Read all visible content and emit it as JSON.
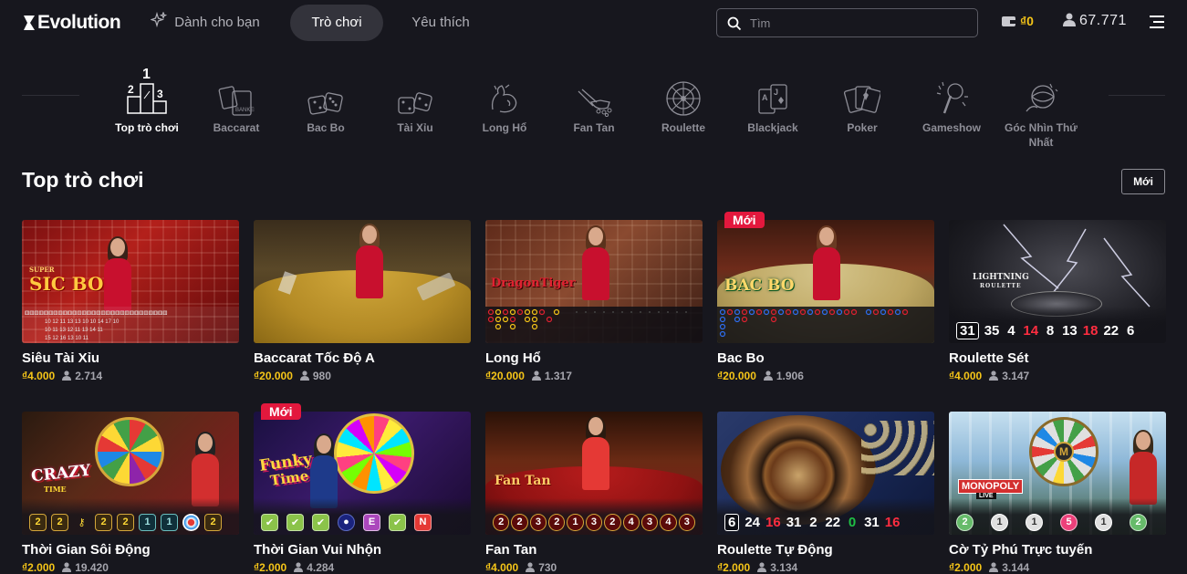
{
  "header": {
    "logo_text": "Evolution",
    "nav": [
      {
        "label": "Dành cho bạn"
      },
      {
        "label": "Trò chơi"
      },
      {
        "label": "Yêu thích"
      }
    ],
    "search_placeholder": "Tìm",
    "wallet_amount": "₫0",
    "player_count": "67.771"
  },
  "categories": [
    {
      "label": "Top trò chơi"
    },
    {
      "label": "Baccarat"
    },
    {
      "label": "Bac Bo"
    },
    {
      "label": "Tài Xỉu"
    },
    {
      "label": "Long Hổ"
    },
    {
      "label": "Fan Tan"
    },
    {
      "label": "Roulette"
    },
    {
      "label": "Blackjack"
    },
    {
      "label": "Poker"
    },
    {
      "label": "Gameshow"
    },
    {
      "label": "Góc Nhìn Thứ Nhất"
    }
  ],
  "section": {
    "title": "Top trò chơi",
    "sort_label": "Mới"
  },
  "games": [
    {
      "name": "Siêu Tài Xỉu",
      "bet": "₫4.000",
      "players": "2.714",
      "logo": "SIC BO",
      "logo_prefix": "SUPER"
    },
    {
      "name": "Baccarat Tốc Độ A",
      "bet": "₫20.000",
      "players": "980"
    },
    {
      "name": "Long Hổ",
      "bet": "₫20.000",
      "players": "1.317",
      "logo": "DragonTiger"
    },
    {
      "name": "Bac Bo",
      "bet": "₫20.000",
      "players": "1.906",
      "badge": "Mới",
      "logo": "BAC BO"
    },
    {
      "name": "Roulette Sét",
      "bet": "₫4.000",
      "players": "3.147",
      "logo": "LIGHTNING",
      "logo_sub": "ROULETTE",
      "results": [
        "31",
        "35",
        "4",
        "14",
        "8",
        "13",
        "18",
        "22",
        "6"
      ]
    },
    {
      "name": "Thời Gian Sôi Động",
      "bet": "₫2.000",
      "players": "19.420",
      "logo": "CRAZY",
      "logo_sub": "TIME",
      "results": [
        "2",
        "2",
        "2",
        "2",
        "1",
        "1",
        "2"
      ]
    },
    {
      "name": "Thời Gian Vui Nhộn",
      "bet": "₫2.000",
      "players": "4.284",
      "badge": "Mới",
      "logo": "Funky",
      "logo_sub": "Time",
      "results": [
        "E",
        "N"
      ]
    },
    {
      "name": "Fan Tan",
      "bet": "₫4.000",
      "players": "730",
      "logo": "Fan Tan",
      "results": [
        "2",
        "2",
        "3",
        "2",
        "1",
        "3",
        "2",
        "4",
        "3",
        "4",
        "3"
      ]
    },
    {
      "name": "Roulette Tự Động",
      "bet": "₫2.000",
      "players": "3.134",
      "results": [
        "6",
        "24",
        "16",
        "31",
        "2",
        "22",
        "0",
        "31",
        "16"
      ]
    },
    {
      "name": "Cờ Tỷ Phú Trực tuyến",
      "bet": "₫2.000",
      "players": "3.144",
      "logo": "MONOPOLY",
      "logo_sub": "LIVE",
      "results": [
        "2",
        "1",
        "1",
        "5",
        "1",
        "2"
      ]
    }
  ]
}
